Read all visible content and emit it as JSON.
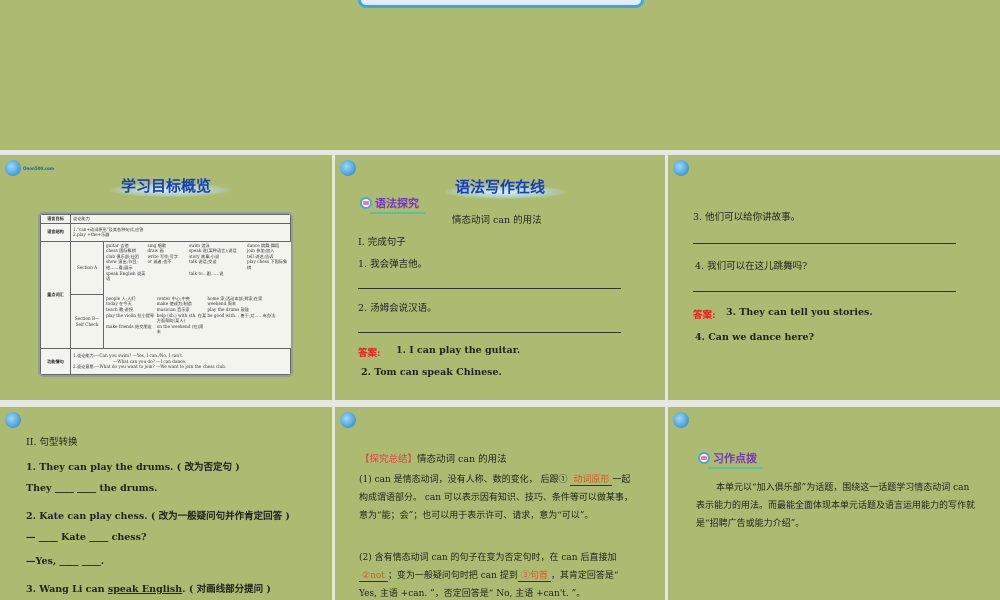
{
  "slide2": {
    "title": "学习目标概览",
    "table": {
      "r1": {
        "h": "语言目标",
        "v": "谈论能力"
      },
      "r2": {
        "h": "语言结构",
        "v1": "1.\"can+动词原形\"及其各种句式,应答",
        "v2": "2.play +the+乐器"
      },
      "r3": {
        "h": "重点词汇",
        "secA": "Section A",
        "secA_words": [
          "guitar 吉他",
          "sing 唱歌",
          "swim 游泳",
          "dance 跳舞;舞蹈",
          "chess 国际象棋",
          "draw 画",
          "speak 说(某种语言);说话",
          "join 参加;加入",
          "club 俱乐部;社团",
          "write 写作;写字",
          "story 故事;小说",
          "tell 讲述;告诉",
          "show 演出;节目;给……看;展示",
          "or 或者;也不",
          "talk 说话;交谈",
          "play chess 下国际象棋",
          "speak English 说英语",
          "",
          "talk to…跟……说"
        ],
        "secB": "Section B—Self Check",
        "secB_words": [
          "people 人;人们",
          "center 中心;中央",
          "home 家;活动本部;到家;在家",
          "today 在今天",
          "make 使成为;制造",
          "weekend 周末",
          "teach 教;讲授",
          "musician 音乐家",
          "play the drums 敲鼓",
          "play the violin 拉小提琴",
          "help (sb.) with sth. 在某方面帮助(某人)",
          "be good with… 善于;对……有办法",
          "make friends 结交朋友",
          "on the weekend (在)周末"
        ]
      },
      "r4": {
        "h": "功能情句",
        "l1": "1.谈论能力:—Can you swim? —Yes, I can./No, I can't.",
        "l2": "—What can you do? —I can dance.",
        "l3": "2.谈论意愿:—What do you want to join? —We want to join the chess club."
      }
    }
  },
  "slide3": {
    "title": "语法写作在线",
    "badge": "语法探究",
    "subtitle": "情态动词 can 的用法",
    "section": "I. 完成句子",
    "q1": "1. 我会弹吉他。",
    "q2": "2. 汤姆会说汉语。",
    "answer_label": "答案:",
    "a1": "1. I can play the guitar.",
    "a2": "2. Tom can speak Chinese."
  },
  "slide4": {
    "q3": "3. 他们可以给你讲故事。",
    "q4": "4. 我们可以在这儿跳舞吗?",
    "answer_label": "答案:",
    "a3": "3. They can tell you stories.",
    "a4": "4. Can we dance here?"
  },
  "slide5": {
    "section": "II. 句型转换",
    "l1": "1. They can play the drums. ( 改为否定句 )",
    "l2": "They ____ ____  the drums.",
    "l3": "2. Kate can play chess. ( 改为一般疑问句并作肯定回答 )",
    "l4": "— ____ Kate ____ chess?",
    "l5": "—Yes, ____ ____.",
    "l6a": "3. Wang Li can ",
    "l6u": "speak English",
    "l6b": ". ( 对画线部分提问 )"
  },
  "slide6": {
    "head_red": "【探究总结】",
    "head": "情态动词 can 的用法",
    "p1a": "(1) can 是情态动词，没有人称、数的变化， 后跟① ",
    "p1fill": "动词原形",
    "p1b": "一起构成谓语部分。 can 可以表示因有知识、技巧、条件等可以做某事， 意为“能；会”；也可以用于表示许可、请求，意为“可以”。",
    "p2a": "(2) 含有情态动词 can 的句子在变为否定句时，在 can 后直接加 ",
    "p2fill1": "②not",
    "p2b": "；变为一般疑问句时把 can 提到",
    "p2fill2": "③句首",
    "p2c": "，其肯定回答是“ Yes, 主语 +can. ”，否定回答是“ No, 主语 +can't. ”。"
  },
  "slide7": {
    "badge": "习作点拨",
    "text": "本单元以“加入俱乐部”为话题，围绕这一话题学习情态动词 can 表示能力的用法。而最能全面体现本单元话题及语言运用能力的写作就是“招聘广告或能力介绍”。"
  },
  "logo_text": "Onon500.com"
}
